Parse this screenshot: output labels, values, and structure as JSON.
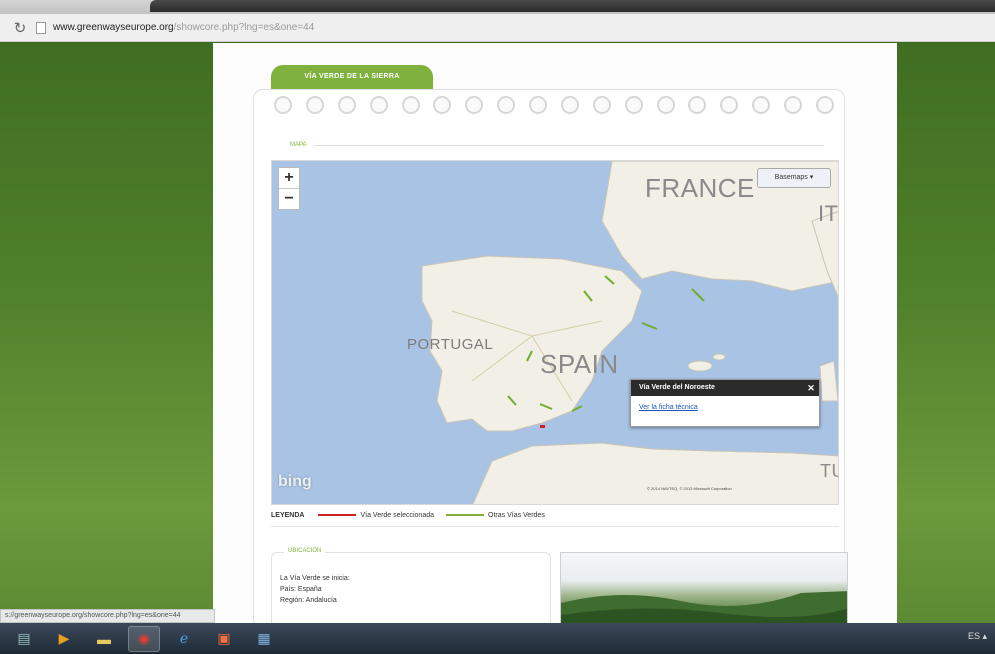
{
  "browser": {
    "url_host": "www.greenwayseurope.org",
    "url_path": "/showcore.php?lng=es&one=44"
  },
  "page": {
    "tab_title": "VÍA VERDE DE LA SIERRA",
    "map_section_label": "MAPA",
    "map": {
      "basemap_label": "Basemaps ▾",
      "zoom_in": "+",
      "zoom_out": "−",
      "countries": {
        "france": "FRANCE",
        "portugal": "PORTUGAL",
        "spain": "SPAIN",
        "it": "IT",
        "tu": "TU"
      },
      "popup_title": "Vía Verde del Noroeste",
      "popup_close": "✕",
      "popup_link": "Ver la ficha técnica",
      "logo": "bing",
      "copyright": "© 2014 NAVTEQ, © 2013 Microsoft Corporation"
    },
    "legend": {
      "label": "LEYENDA",
      "selected": "Vía Verde seleccionada",
      "others": "Otras Vías Verdes",
      "selected_color": "#cc2222",
      "others_color": "#7fb23d"
    },
    "ubicacion": {
      "label": "UBICACIÓN",
      "lines": [
        "La Vía Verde se inicia:",
        "País: España",
        "Región: Andalucía"
      ]
    }
  },
  "status_bar": "s://greenwayseurope.org/showcore.php?lng=es&one=44",
  "taskbar": {
    "items": [
      "windows-explorer",
      "media-player",
      "folder",
      "chrome",
      "internet-explorer",
      "photo-app",
      "remote-desktop"
    ],
    "tray_text": "ES ▴"
  }
}
